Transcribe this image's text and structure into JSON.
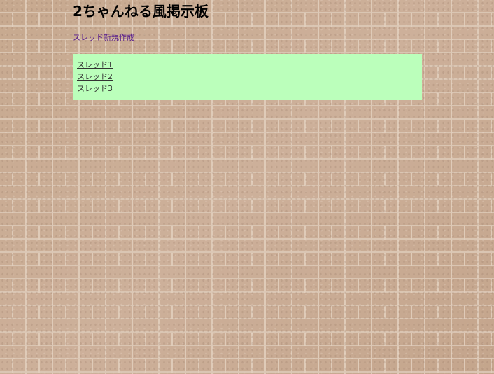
{
  "page": {
    "title": "2ちゃんねる風掲示板"
  },
  "actions": {
    "new_thread_label": "スレッド新規作成"
  },
  "threads": [
    {
      "label": "スレッド1"
    },
    {
      "label": "スレッド2"
    },
    {
      "label": "スレッド3"
    }
  ],
  "colors": {
    "thread_box_background": "#bbffbb",
    "page_background": "brick-wall-tan"
  }
}
